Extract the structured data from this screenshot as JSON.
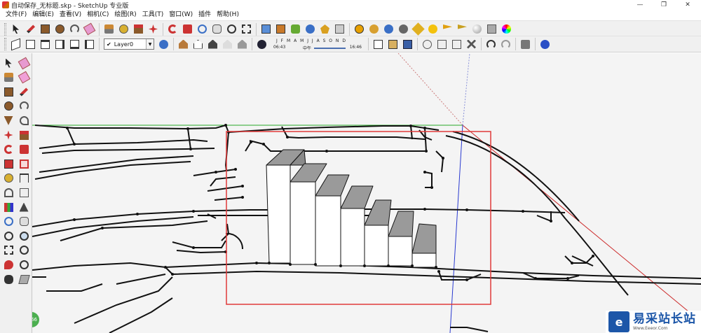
{
  "window": {
    "title": "自动保存_无标题.skp - SketchUp 专业版",
    "min_label": "—",
    "max_label": "❐",
    "close_label": "✕"
  },
  "menu": [
    "文件(F)",
    "编辑(E)",
    "查看(V)",
    "相机(C)",
    "绘图(R)",
    "工具(T)",
    "窗口(W)",
    "插件",
    "帮助(H)"
  ],
  "layer": {
    "value": "Layer0",
    "check": "✔",
    "arrow": "▼"
  },
  "shadow": {
    "months": "J F M A M J J A S O N D",
    "time_start": "06:43",
    "time_mid": "中午",
    "time_end": "16:46"
  },
  "watermark": {
    "logo": "e",
    "name": "易采站长站",
    "url": "Www.Eeeor.Com"
  },
  "badge": "66",
  "colors": {
    "selection_box": "#e03a3a",
    "axis_green": "#28a828",
    "axis_blue": "#2a3ad0",
    "axis_red": "#cc2a2a",
    "brand": "#1c56a8"
  },
  "toolbar1_icons": [
    "select-icon",
    "pencil-icon",
    "rectangle-icon",
    "circle-icon",
    "arc-icon",
    "eraser-icon",
    "paint-bucket-icon",
    "tape-measure-icon",
    "push-pull-icon",
    "move-icon",
    "rotate-icon",
    "follow-me-icon",
    "orbit-icon",
    "pan-icon",
    "zoom-icon",
    "zoom-extents-icon",
    "get-models-icon",
    "share-model-icon",
    "3d-warehouse-icon",
    "component-icon",
    "extension-icon",
    "styles-icon",
    "plugin-m-icon",
    "plugin-s-icon",
    "plugin-r-icon",
    "plugin-r2-icon",
    "plugin-tag-icon",
    "sun-icon",
    "flag-icon",
    "flag2-icon",
    "sphere-icon",
    "section-icon",
    "color-wheel-icon"
  ],
  "toolbar2_icons": [
    "iso-view-icon",
    "top-view-icon",
    "front-view-icon",
    "right-view-icon",
    "back-view-icon",
    "left-view-icon",
    "box-icon",
    "box-textured-icon",
    "box-solid-icon",
    "layer-manager-icon",
    "warehouse-house-icon",
    "house-front-icon",
    "house-back-icon",
    "house-iso-icon",
    "house-outline-icon",
    "shadow-toggle-icon",
    "fog-icon",
    "new-file-icon",
    "open-file-icon",
    "save-icon",
    "cut-icon",
    "copy-icon",
    "paste-icon",
    "delete-icon",
    "undo-icon",
    "redo-icon",
    "print-icon",
    "model-info-icon"
  ],
  "left_icons": [
    "select-icon",
    "eraser-icon",
    "paint-bucket-icon",
    "eraser2-icon",
    "rectangle-icon",
    "pencil-icon",
    "circle-icon",
    "arc-icon",
    "polygon-icon",
    "freehand-icon",
    "move-icon",
    "push-pull-icon",
    "rotate-icon",
    "follow-me-icon",
    "scale-icon",
    "offset-icon",
    "tape-measure-icon",
    "dimension-icon",
    "protractor-icon",
    "text-icon",
    "axes-icon",
    "3d-text-icon",
    "orbit-icon",
    "pan-icon",
    "zoom-icon",
    "zoom-window-icon",
    "zoom-extents-icon",
    "previous-view-icon",
    "position-camera-icon",
    "look-around-icon",
    "walk-icon",
    "section-plane-icon"
  ]
}
